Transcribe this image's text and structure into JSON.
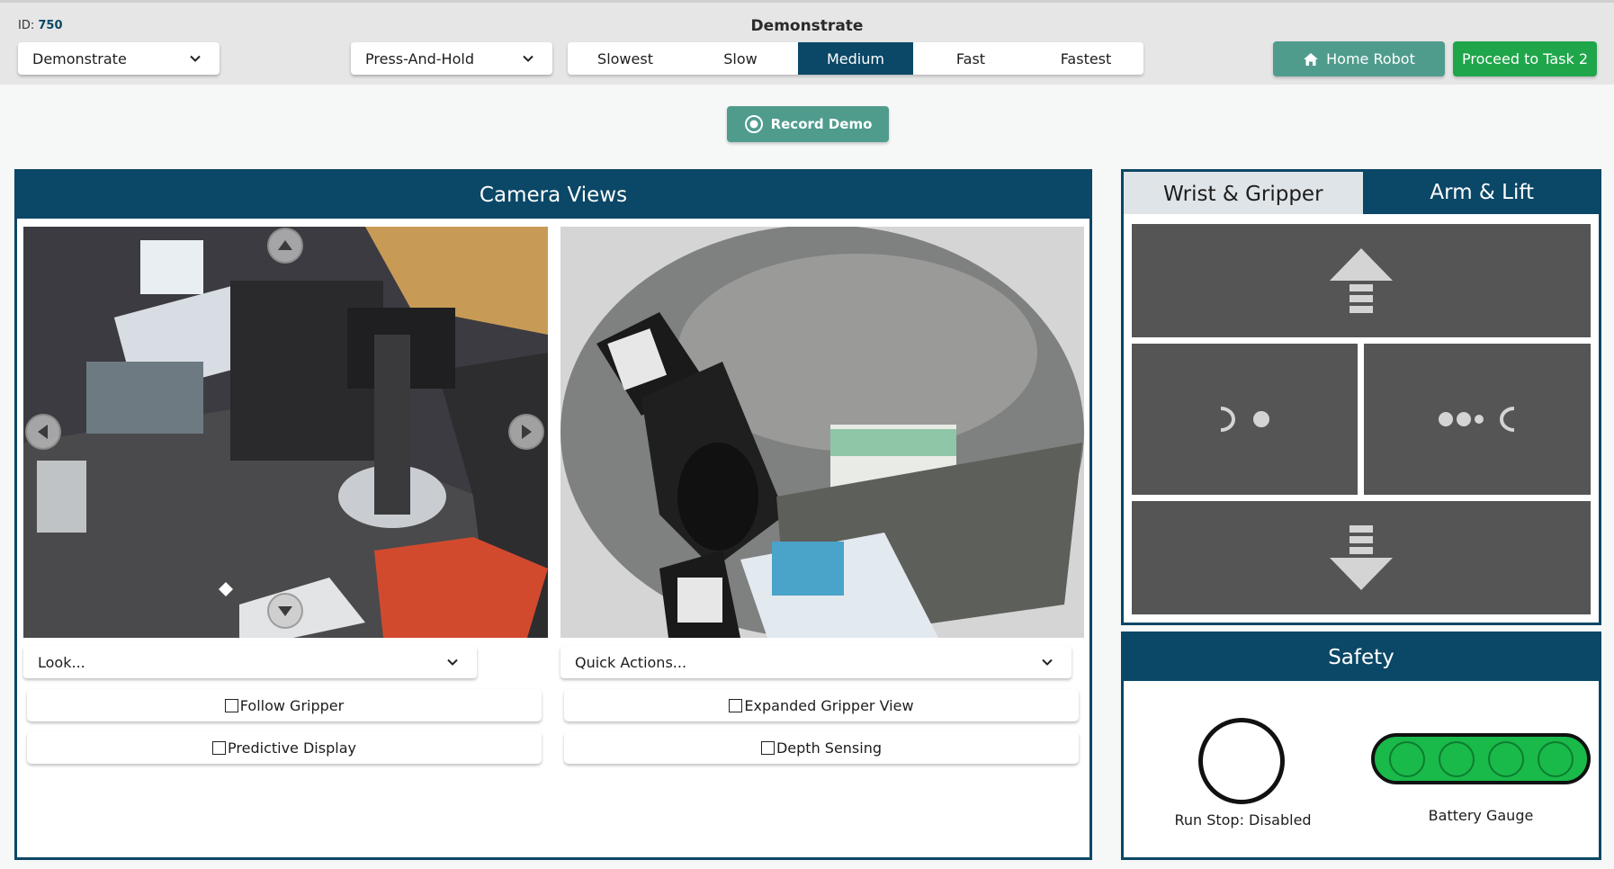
{
  "header": {
    "id_prefix": "ID:",
    "id_value": "750",
    "title": "Demonstrate",
    "mode_dropdown": "Demonstrate",
    "control_dropdown": "Press-And-Hold",
    "speeds": [
      "Slowest",
      "Slow",
      "Medium",
      "Fast",
      "Fastest"
    ],
    "active_speed": "Medium",
    "home_button": "Home Robot",
    "proceed_button": "Proceed to Task 2"
  },
  "record": {
    "label": "Record Demo"
  },
  "camera": {
    "title": "Camera Views",
    "left_dropdown": "Look...",
    "right_dropdown": "Quick Actions...",
    "options": {
      "follow_gripper": "Follow Gripper",
      "predictive_display": "Predictive Display",
      "expanded_gripper": "Expanded Gripper View",
      "depth_sensing": "Depth Sensing"
    }
  },
  "arm_tabs": {
    "wrist": "Wrist & Gripper",
    "arm": "Arm & Lift",
    "active": "Arm & Lift"
  },
  "safety": {
    "title": "Safety",
    "run_stop_label": "Run Stop: Disabled",
    "battery_label": "Battery Gauge",
    "battery_color": "#19b94a"
  },
  "colors": {
    "brand": "#0b4766",
    "teal": "#4f9c8d",
    "green": "#1fa64a",
    "pad": "#555555"
  }
}
